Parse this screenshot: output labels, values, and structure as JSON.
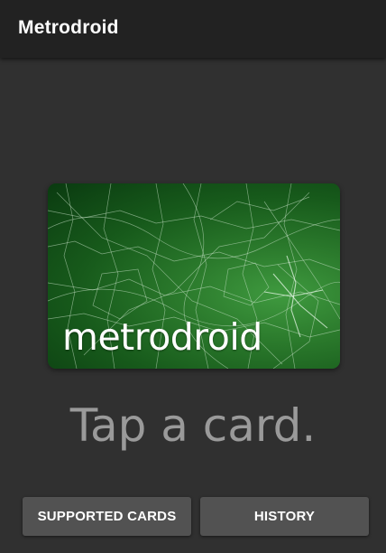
{
  "appbar": {
    "title": "Metrodroid"
  },
  "card": {
    "logo_text": "metrodroid"
  },
  "main": {
    "prompt": "Tap a card."
  },
  "buttons": {
    "supported_cards_label": "SUPPORTED CARDS",
    "history_label": "HISTORY"
  },
  "colors": {
    "background": "#303030",
    "appbar": "#222222",
    "button": "#525252",
    "card_green": "#2b7a2c",
    "prompt_text": "#9a9a9a"
  }
}
